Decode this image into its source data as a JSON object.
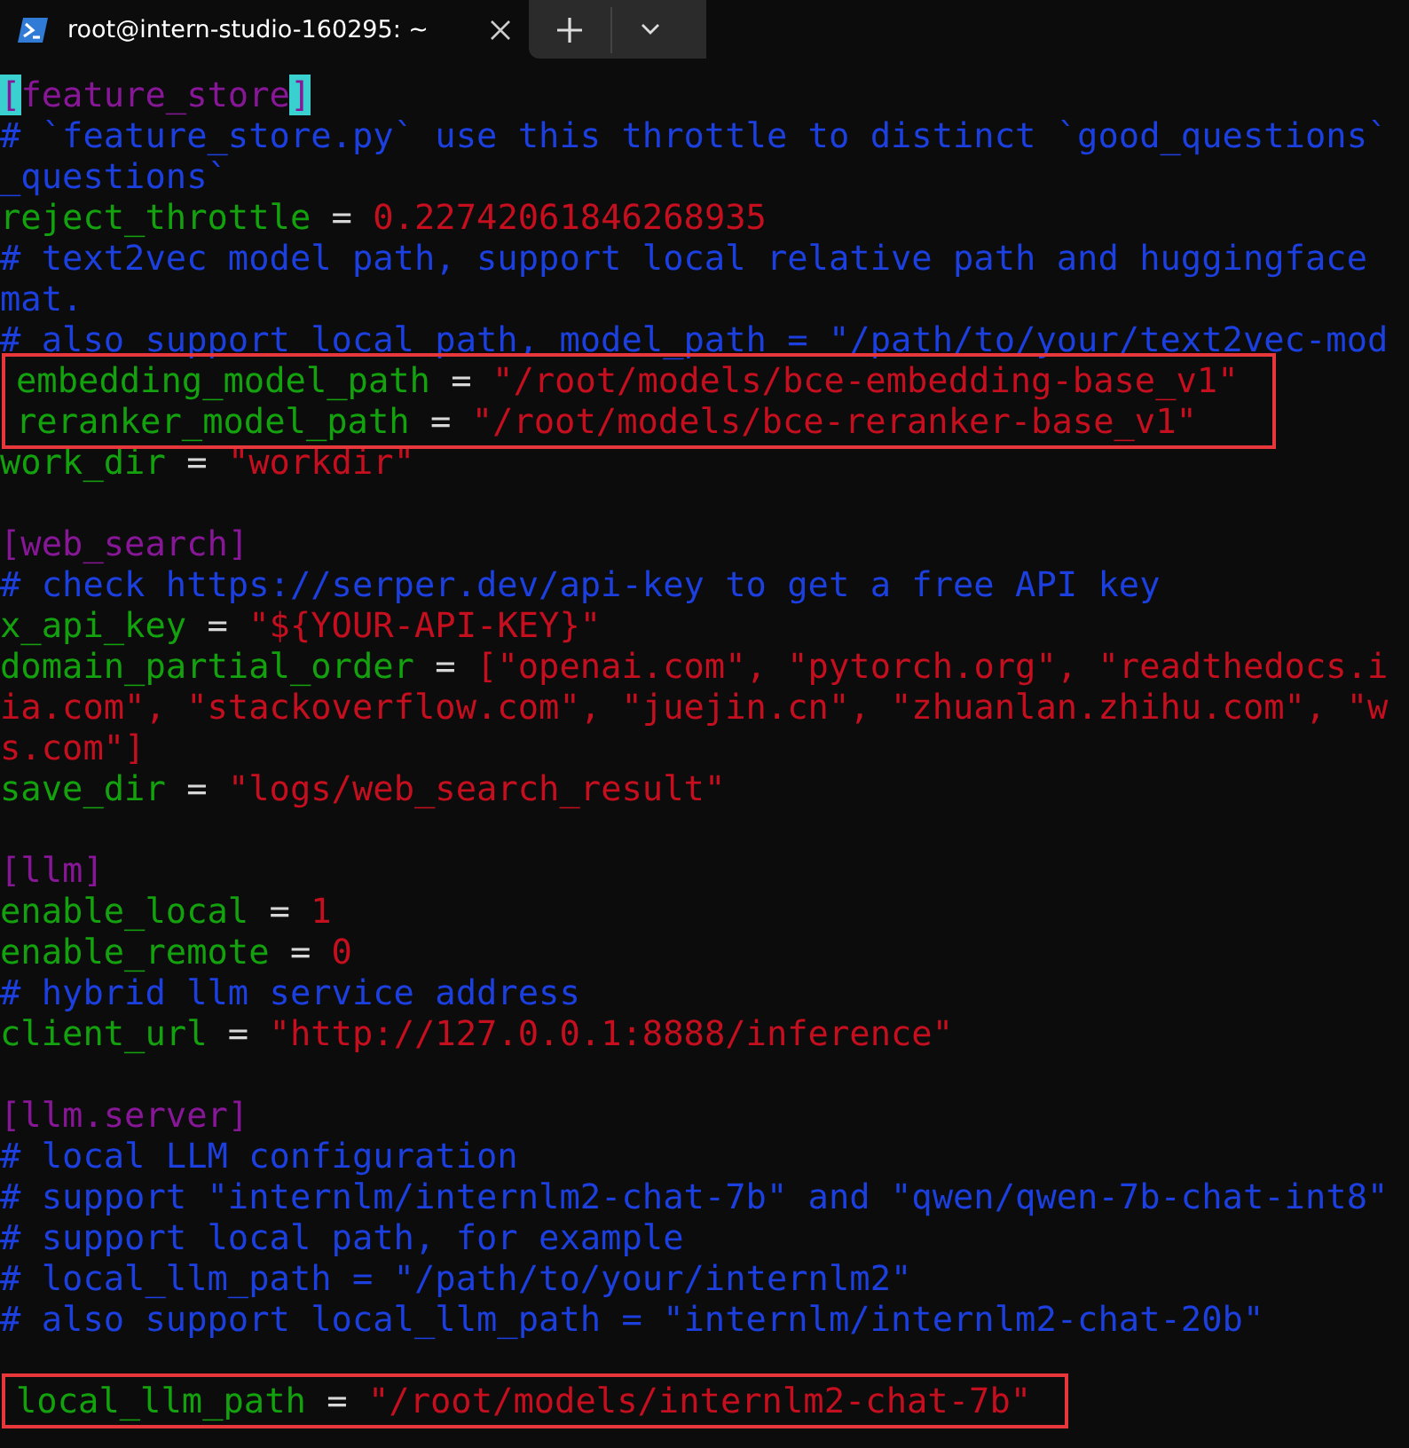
{
  "tabs": [
    {
      "title": "root@intern-studio-160295: ~",
      "selected": true
    }
  ],
  "lines": [
    {
      "kind": "code",
      "boxed": false,
      "segments": [
        {
          "kind": "match",
          "text": "["
        },
        {
          "kind": "section",
          "text": "feature_store"
        },
        {
          "kind": "match",
          "text": "]"
        }
      ]
    },
    {
      "kind": "code",
      "boxed": false,
      "segments": [
        {
          "kind": "comment",
          "text": "# `feature_store.py` use this throttle to distinct `good_questions`"
        }
      ]
    },
    {
      "kind": "code",
      "boxed": false,
      "segments": [
        {
          "kind": "comment",
          "text": "_questions`"
        }
      ]
    },
    {
      "kind": "code",
      "boxed": false,
      "segments": [
        {
          "kind": "key",
          "text": "reject_throttle"
        },
        {
          "kind": "op",
          "text": " = "
        },
        {
          "kind": "string",
          "text": "0.22742061846268935"
        }
      ]
    },
    {
      "kind": "code",
      "boxed": false,
      "segments": [
        {
          "kind": "comment",
          "text": "# text2vec model path, support local relative path and huggingface"
        }
      ]
    },
    {
      "kind": "code",
      "boxed": false,
      "segments": [
        {
          "kind": "comment",
          "text": "mat."
        }
      ]
    },
    {
      "kind": "code",
      "boxed": false,
      "segments": [
        {
          "kind": "comment",
          "text": "# also support local path, model_path = \"/path/to/your/text2vec-mod"
        }
      ]
    },
    {
      "kind": "code",
      "boxed": true,
      "segments": [
        {
          "kind": "key",
          "text": "embedding_model_path"
        },
        {
          "kind": "op",
          "text": " = "
        },
        {
          "kind": "string",
          "text": "\"/root/models/bce-embedding-base_v1\""
        }
      ]
    },
    {
      "kind": "code",
      "boxed": true,
      "segments": [
        {
          "kind": "key",
          "text": "reranker_model_path"
        },
        {
          "kind": "op",
          "text": " = "
        },
        {
          "kind": "string",
          "text": "\"/root/models/bce-reranker-base_v1\""
        }
      ]
    },
    {
      "kind": "code",
      "boxed": false,
      "segments": [
        {
          "kind": "key",
          "text": "work_dir"
        },
        {
          "kind": "op",
          "text": " = "
        },
        {
          "kind": "string",
          "text": "\"workdir\""
        }
      ]
    },
    {
      "kind": "blank"
    },
    {
      "kind": "code",
      "boxed": false,
      "segments": [
        {
          "kind": "section",
          "text": "[web_search]"
        }
      ]
    },
    {
      "kind": "code",
      "boxed": false,
      "segments": [
        {
          "kind": "comment",
          "text": "# check https://serper.dev/api-key to get a free API key"
        }
      ]
    },
    {
      "kind": "code",
      "boxed": false,
      "segments": [
        {
          "kind": "key",
          "text": "x_api_key"
        },
        {
          "kind": "op",
          "text": " = "
        },
        {
          "kind": "string",
          "text": "\"${YOUR-API-KEY}\""
        }
      ]
    },
    {
      "kind": "code",
      "boxed": false,
      "segments": [
        {
          "kind": "key",
          "text": "domain_partial_order"
        },
        {
          "kind": "op",
          "text": " = "
        },
        {
          "kind": "string",
          "text": "[\"openai.com\", \"pytorch.org\", \"readthedocs.i"
        }
      ]
    },
    {
      "kind": "code",
      "boxed": false,
      "segments": [
        {
          "kind": "string",
          "text": "ia.com\", \"stackoverflow.com\", \"juejin.cn\", \"zhuanlan.zhihu.com\", \"w"
        }
      ]
    },
    {
      "kind": "code",
      "boxed": false,
      "segments": [
        {
          "kind": "string",
          "text": "s.com\"]"
        }
      ]
    },
    {
      "kind": "code",
      "boxed": false,
      "segments": [
        {
          "kind": "key",
          "text": "save_dir"
        },
        {
          "kind": "op",
          "text": " = "
        },
        {
          "kind": "string",
          "text": "\"logs/web_search_result\""
        }
      ]
    },
    {
      "kind": "blank"
    },
    {
      "kind": "code",
      "boxed": false,
      "segments": [
        {
          "kind": "section",
          "text": "[llm]"
        }
      ]
    },
    {
      "kind": "code",
      "boxed": false,
      "segments": [
        {
          "kind": "key",
          "text": "enable_local"
        },
        {
          "kind": "op",
          "text": " = "
        },
        {
          "kind": "string",
          "text": "1"
        }
      ]
    },
    {
      "kind": "code",
      "boxed": false,
      "segments": [
        {
          "kind": "key",
          "text": "enable_remote"
        },
        {
          "kind": "op",
          "text": " = "
        },
        {
          "kind": "string",
          "text": "0"
        }
      ]
    },
    {
      "kind": "code",
      "boxed": false,
      "segments": [
        {
          "kind": "comment",
          "text": "# hybrid llm service address"
        }
      ]
    },
    {
      "kind": "code",
      "boxed": false,
      "segments": [
        {
          "kind": "key",
          "text": "client_url"
        },
        {
          "kind": "op",
          "text": " = "
        },
        {
          "kind": "string",
          "text": "\"http://127.0.0.1:8888/inference\""
        }
      ]
    },
    {
      "kind": "blank"
    },
    {
      "kind": "code",
      "boxed": false,
      "segments": [
        {
          "kind": "section",
          "text": "[llm.server]"
        }
      ]
    },
    {
      "kind": "code",
      "boxed": false,
      "segments": [
        {
          "kind": "comment",
          "text": "# local LLM configuration"
        }
      ]
    },
    {
      "kind": "code",
      "boxed": false,
      "segments": [
        {
          "kind": "comment",
          "text": "# support \"internlm/internlm2-chat-7b\" and \"qwen/qwen-7b-chat-int8\""
        }
      ]
    },
    {
      "kind": "code",
      "boxed": false,
      "segments": [
        {
          "kind": "comment",
          "text": "# support local path, for example"
        }
      ]
    },
    {
      "kind": "code",
      "boxed": false,
      "segments": [
        {
          "kind": "comment",
          "text": "# local_llm_path = \"/path/to/your/internlm2\""
        }
      ]
    },
    {
      "kind": "code",
      "boxed": false,
      "segments": [
        {
          "kind": "comment",
          "text": "# also support local_llm_path = \"internlm/internlm2-chat-20b\""
        }
      ]
    },
    {
      "kind": "blank"
    },
    {
      "kind": "code",
      "boxed": true,
      "segments": [
        {
          "kind": "key",
          "text": "local_llm_path"
        },
        {
          "kind": "op",
          "text": " = "
        },
        {
          "kind": "string",
          "text": "\"/root/models/internlm2-chat-7b\""
        }
      ]
    }
  ]
}
